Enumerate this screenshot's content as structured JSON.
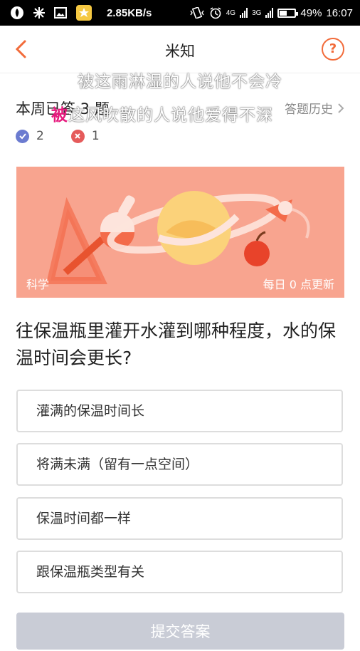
{
  "statusbar": {
    "net_speed": "2.85KB/s",
    "net1": "4G",
    "net2": "3G",
    "battery_percent": "49%",
    "battery_level": 0.49,
    "time": "16:07"
  },
  "nav": {
    "title": "米知"
  },
  "overlay": {
    "line1": "被这雨淋湿的人说他不会冷",
    "line2_highlight": "被",
    "line2_rest": "这风吹散的人说他爱得不深"
  },
  "week": {
    "title": "本周已答 3 题",
    "history_label": "答题历史"
  },
  "stats": {
    "correct": "2",
    "wrong": "1"
  },
  "banner": {
    "tag": "科学",
    "update": "每日 0 点更新",
    "colors": {
      "bg": "#f8a48f",
      "planet": "#fbd27a",
      "accent": "#f36b4a"
    }
  },
  "question": {
    "text": "往保温瓶里灌开水灌到哪种程度，水的保温时间会更长?"
  },
  "options": [
    "灌满的保温时间长",
    "将满未满（留有一点空间）",
    "保温时间都一样",
    "跟保温瓶类型有关"
  ],
  "submit": {
    "label": "提交答案"
  },
  "colors": {
    "accent": "#f26b3a",
    "correct": "#6b7bd0",
    "wrong": "#e55b5b",
    "submit_disabled": "#c9ccd6"
  }
}
